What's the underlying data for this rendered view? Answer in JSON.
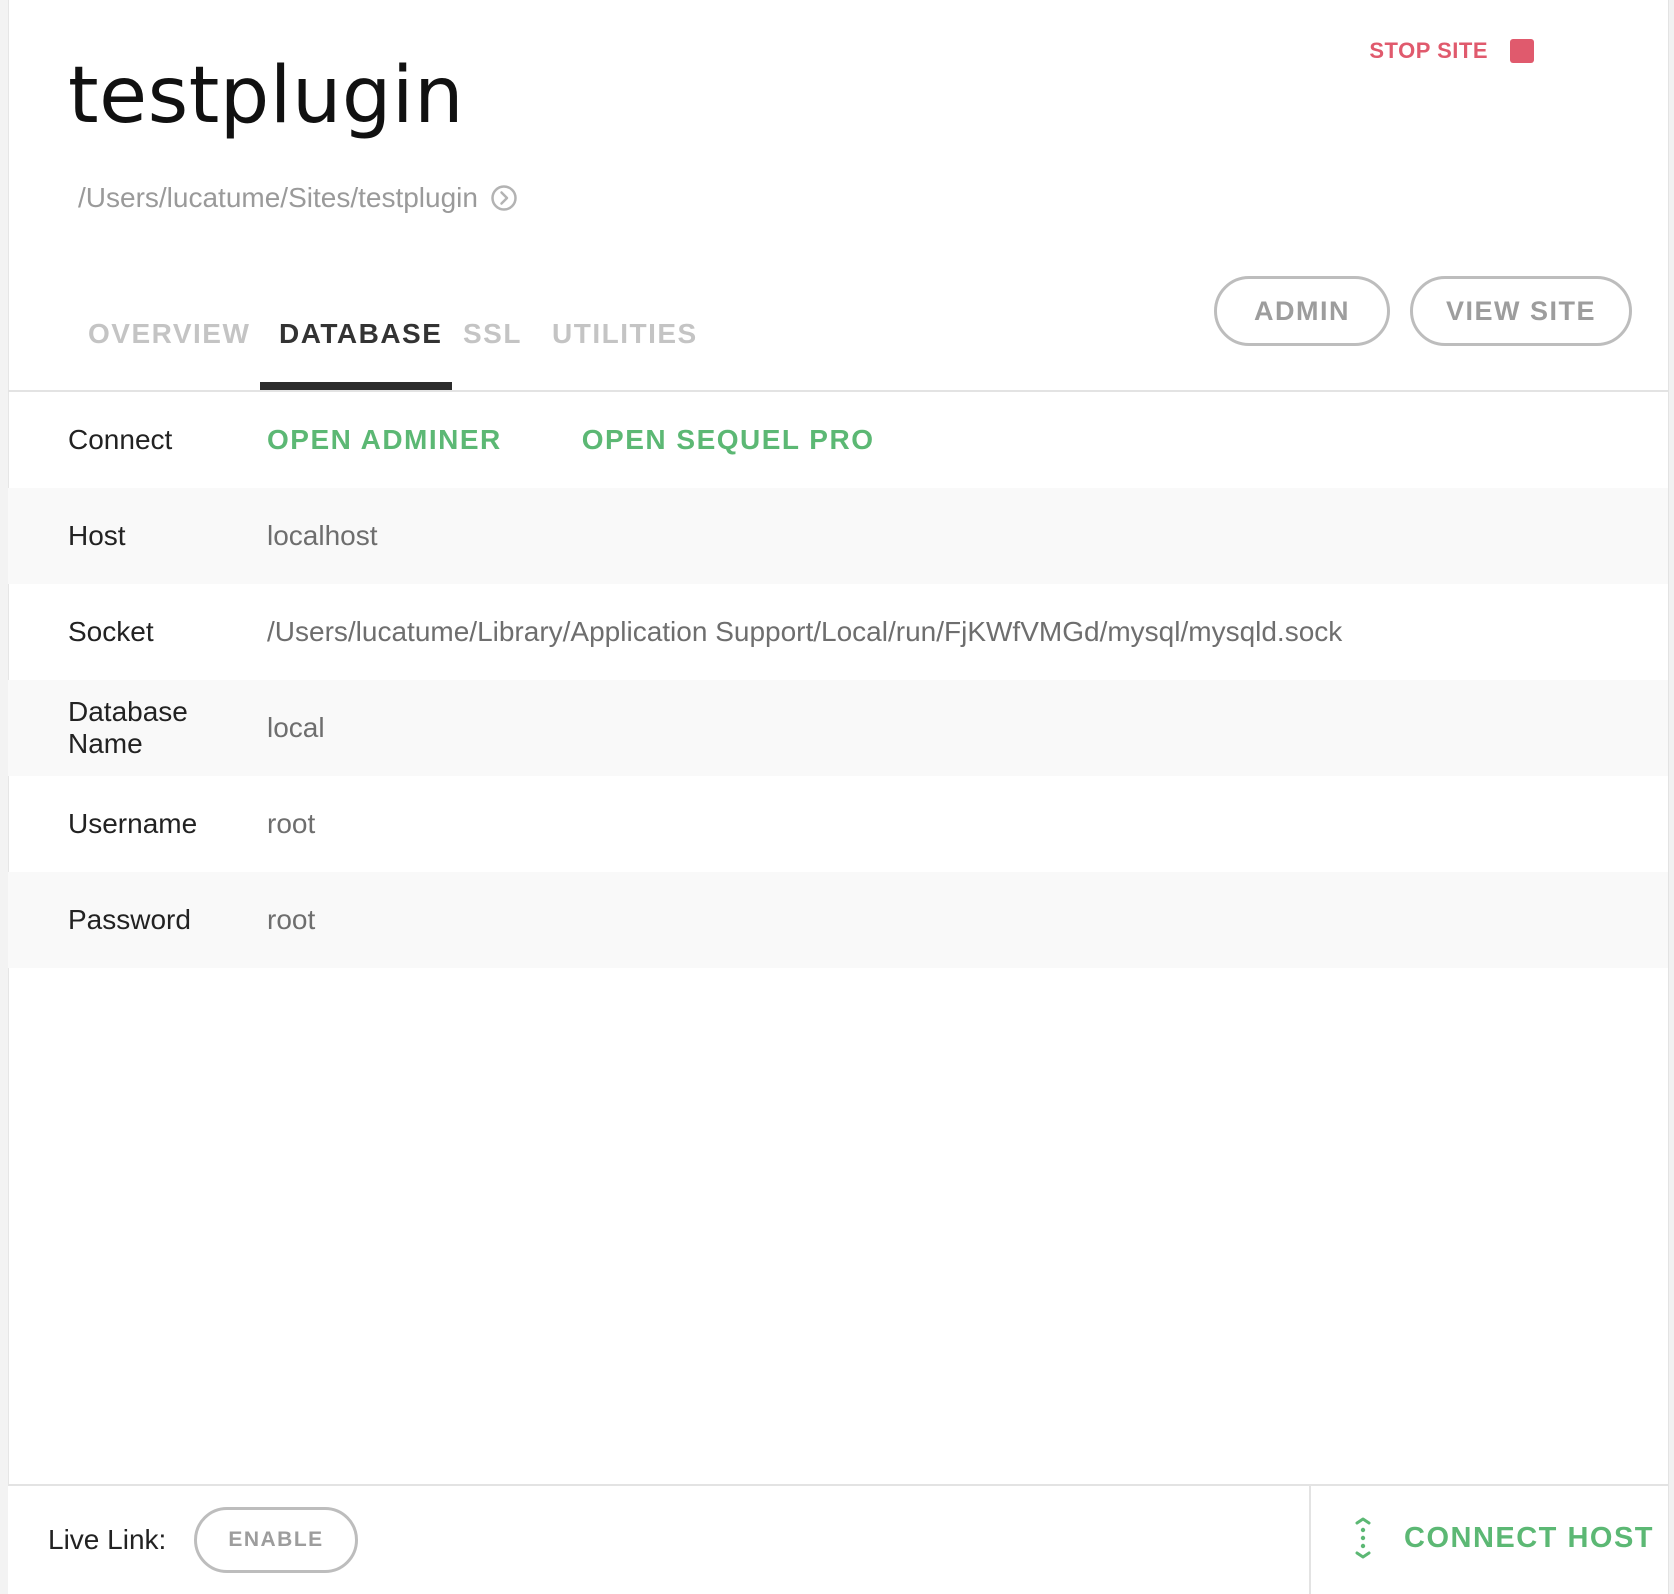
{
  "site": {
    "title": "testplugin",
    "path": "/Users/lucatume/Sites/testplugin",
    "stop_label": "STOP SITE"
  },
  "header_buttons": {
    "admin": "ADMIN",
    "view_site": "VIEW SITE"
  },
  "tabs": [
    {
      "label": "OVERVIEW",
      "active": false
    },
    {
      "label": "DATABASE",
      "active": true
    },
    {
      "label": "SSL",
      "active": false
    },
    {
      "label": "UTILITIES",
      "active": false
    }
  ],
  "database": {
    "connect_label": "Connect",
    "connect_links": [
      "OPEN ADMINER",
      "OPEN SEQUEL PRO"
    ],
    "rows": [
      {
        "label": "Host",
        "value": "localhost"
      },
      {
        "label": "Socket",
        "value": "/Users/lucatume/Library/Application Support/Local/run/FjKWfVMGd/mysql/mysqld.sock"
      },
      {
        "label": "Database Name",
        "value": "local"
      },
      {
        "label": "Username",
        "value": "root"
      },
      {
        "label": "Password",
        "value": "root"
      }
    ]
  },
  "footer": {
    "live_link_label": "Live Link:",
    "enable_label": "ENABLE",
    "connect_host_label": "CONNECT HOST"
  },
  "icons": {
    "path": "circle-arrow-right-icon",
    "stop": "stop-square-icon",
    "connect_host": "connect-host-icon"
  },
  "colors": {
    "accent_green": "#5cb874",
    "stop_red": "#e05a6d",
    "muted_text": "#9d9d9d",
    "active_tab": "#333333"
  }
}
